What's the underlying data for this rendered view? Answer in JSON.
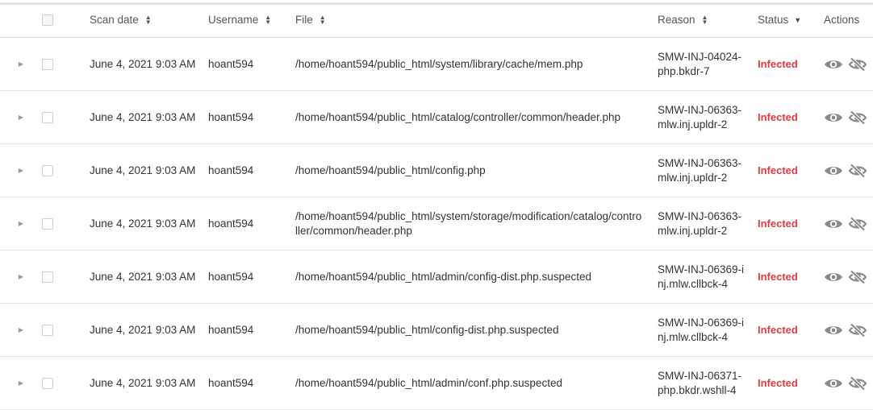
{
  "header": {
    "scan_date": "Scan date",
    "username": "Username",
    "file": "File",
    "reason": "Reason",
    "status": "Status",
    "actions": "Actions"
  },
  "colors": {
    "infected": "#e03a3e",
    "icon": "#8a8a8a"
  },
  "rows": [
    {
      "date": "June 4, 2021 9:03 AM",
      "username": "hoant594",
      "file": "/home/hoant594/public_html/system/library/cache/mem.php",
      "reason": "SMW-INJ-04024-php.bkdr-7",
      "status": "Infected"
    },
    {
      "date": "June 4, 2021 9:03 AM",
      "username": "hoant594",
      "file": "/home/hoant594/public_html/catalog/controller/common/header.php",
      "reason": "SMW-INJ-06363-mlw.inj.upldr-2",
      "status": "Infected"
    },
    {
      "date": "June 4, 2021 9:03 AM",
      "username": "hoant594",
      "file": "/home/hoant594/public_html/config.php",
      "reason": "SMW-INJ-06363-mlw.inj.upldr-2",
      "status": "Infected"
    },
    {
      "date": "June 4, 2021 9:03 AM",
      "username": "hoant594",
      "file": "/home/hoant594/public_html/system/storage/modification/catalog/controller/common/header.php",
      "reason": "SMW-INJ-06363-mlw.inj.upldr-2",
      "status": "Infected"
    },
    {
      "date": "June 4, 2021 9:03 AM",
      "username": "hoant594",
      "file": "/home/hoant594/public_html/admin/config-dist.php.suspected",
      "reason": "SMW-INJ-06369-inj.mlw.cllbck-4",
      "status": "Infected"
    },
    {
      "date": "June 4, 2021 9:03 AM",
      "username": "hoant594",
      "file": "/home/hoant594/public_html/config-dist.php.suspected",
      "reason": "SMW-INJ-06369-inj.mlw.cllbck-4",
      "status": "Infected"
    },
    {
      "date": "June 4, 2021 9:03 AM",
      "username": "hoant594",
      "file": "/home/hoant594/public_html/admin/conf.php.suspected",
      "reason": "SMW-INJ-06371-php.bkdr.wshll-4",
      "status": "Infected"
    }
  ]
}
